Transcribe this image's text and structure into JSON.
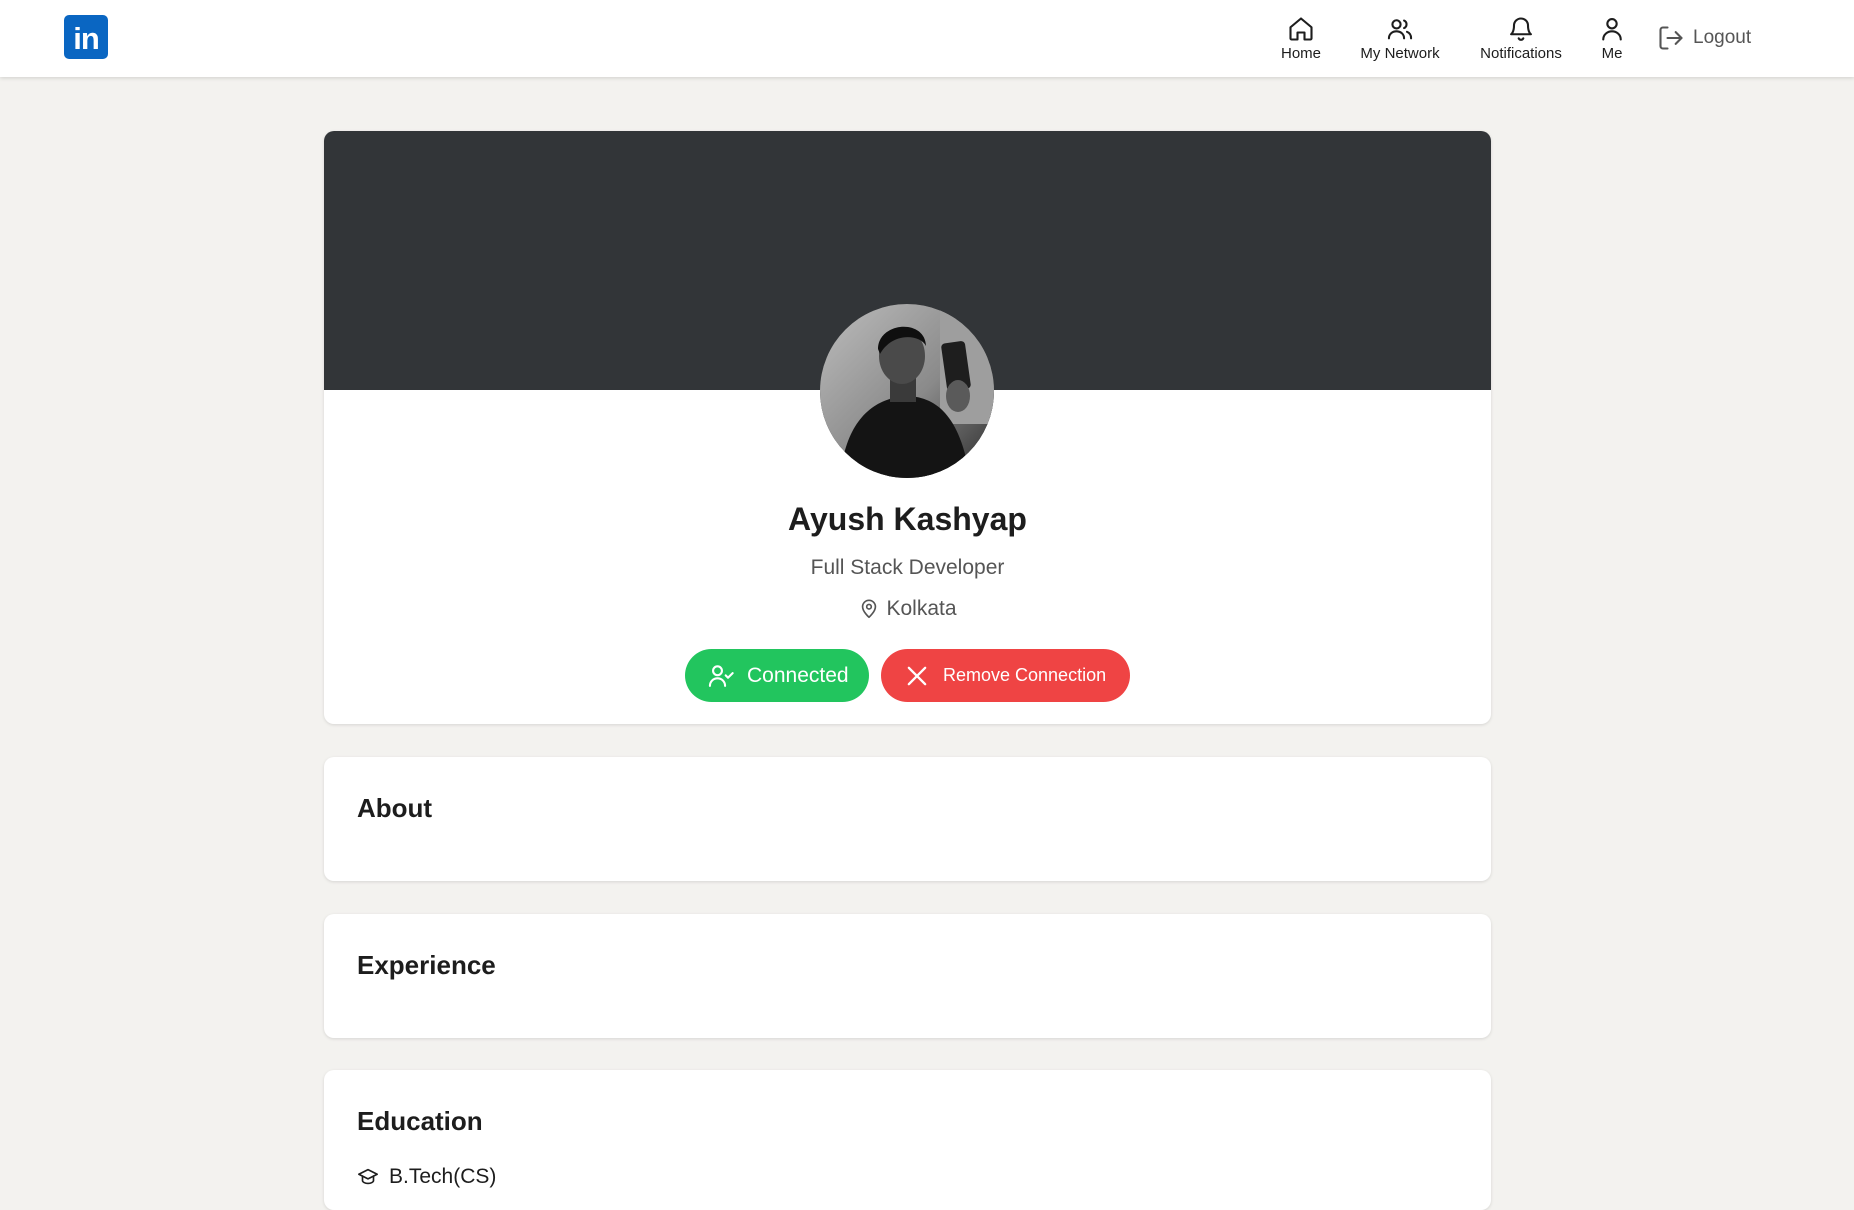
{
  "brand": {
    "logo_text": "in",
    "color": "#0a66c2"
  },
  "nav": {
    "home": "Home",
    "network": "My Network",
    "notifications": "Notifications",
    "me": "Me",
    "logout": "Logout"
  },
  "profile": {
    "name": "Ayush Kashyap",
    "headline": "Full Stack Developer",
    "location": "Kolkata",
    "connected_label": "Connected",
    "remove_label": "Remove Connection",
    "banner_color": "#323538",
    "connected_color": "#22c55e",
    "remove_color": "#ef4444"
  },
  "sections": {
    "about": {
      "title": "About"
    },
    "experience": {
      "title": "Experience"
    },
    "education": {
      "title": "Education",
      "items": [
        {
          "degree": "B.Tech(CS)",
          "icon": "graduation-cap-icon"
        }
      ]
    }
  }
}
